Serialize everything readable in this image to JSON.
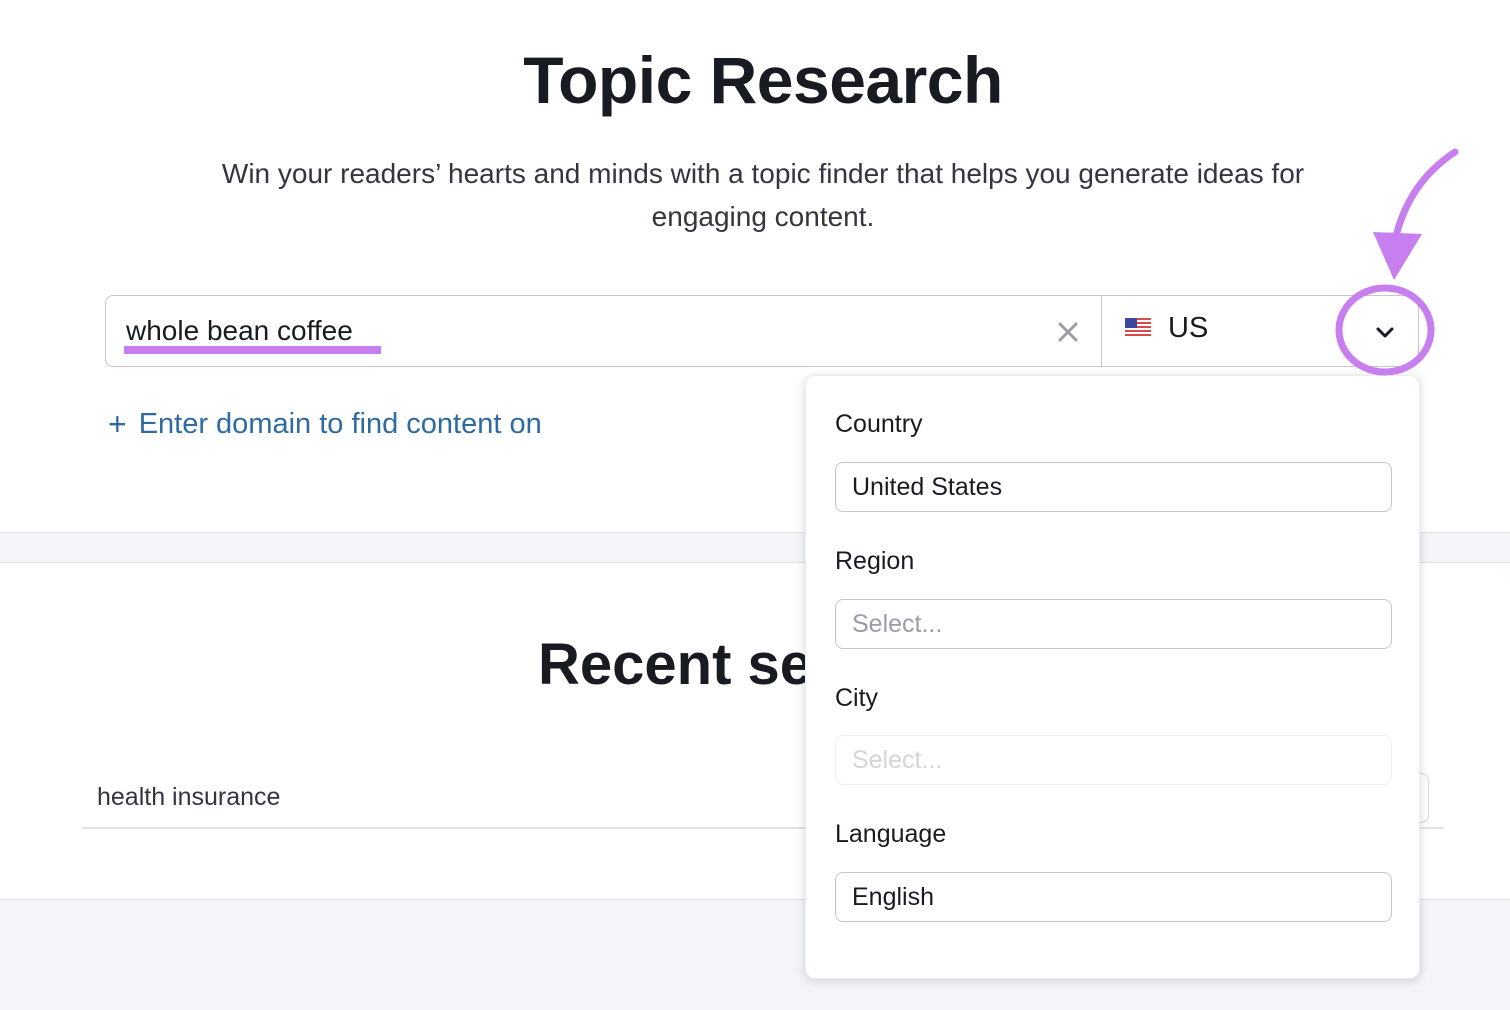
{
  "header": {
    "title": "Topic Research",
    "subtitle": "Win your readers’ hearts and minds with a topic finder that helps you generate ideas for engaging content."
  },
  "search": {
    "value": "whole bean coffee",
    "clear_icon": "close-icon",
    "country_flag": "us-flag-icon",
    "country_code": "US",
    "chevron_icon": "chevron-down-icon"
  },
  "add_domain": {
    "icon": "plus-icon",
    "label": "Enter domain to find content on"
  },
  "recent": {
    "title": "Recent searches",
    "items": [
      {
        "keyword": "health insurance"
      }
    ]
  },
  "location_dropdown": {
    "country": {
      "label": "Country",
      "value": "United States"
    },
    "region": {
      "label": "Region",
      "placeholder": "Select..."
    },
    "city": {
      "label": "City",
      "placeholder": "Select...",
      "disabled": true
    },
    "language": {
      "label": "Language",
      "value": "English"
    }
  },
  "annotations": {
    "accent_color": "#c77ff0"
  }
}
